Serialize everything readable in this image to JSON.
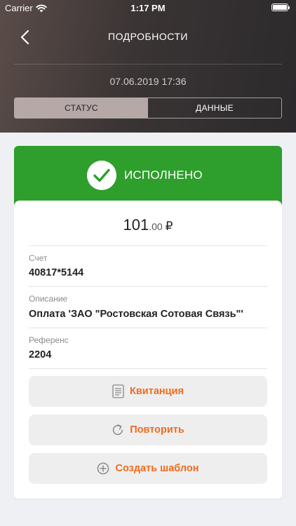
{
  "status_bar": {
    "carrier": "Carrier",
    "time": "1:17 PM"
  },
  "nav": {
    "title": "ПОДРОБНОСТИ",
    "back_icon": "chevron-left-icon"
  },
  "datetime": "07.06.2019 17:36",
  "segments": [
    {
      "label": "СТАТУС",
      "active": true
    },
    {
      "label": "ДАННЫЕ",
      "active": false
    }
  ],
  "status": {
    "label": "ИСПОЛНЕНО",
    "icon": "check-circle-icon",
    "color": "#2e9e2d"
  },
  "amount": {
    "integer": "101",
    "fraction": ".00",
    "currency": "₽"
  },
  "fields": [
    {
      "label": "Счет",
      "value": "40817*5144"
    },
    {
      "label": "Описание",
      "value": "Оплата 'ЗАО \"Ростовская Сотовая Связь\"'"
    },
    {
      "label": "Референс",
      "value": "2204"
    }
  ],
  "actions": [
    {
      "label": "Квитанция",
      "icon": "receipt-icon"
    },
    {
      "label": "Повторить",
      "icon": "repeat-icon"
    },
    {
      "label": "Создать шаблон",
      "icon": "plus-circle-icon"
    }
  ],
  "colors": {
    "accent": "#ef6c1f",
    "success": "#2e9e2d"
  }
}
